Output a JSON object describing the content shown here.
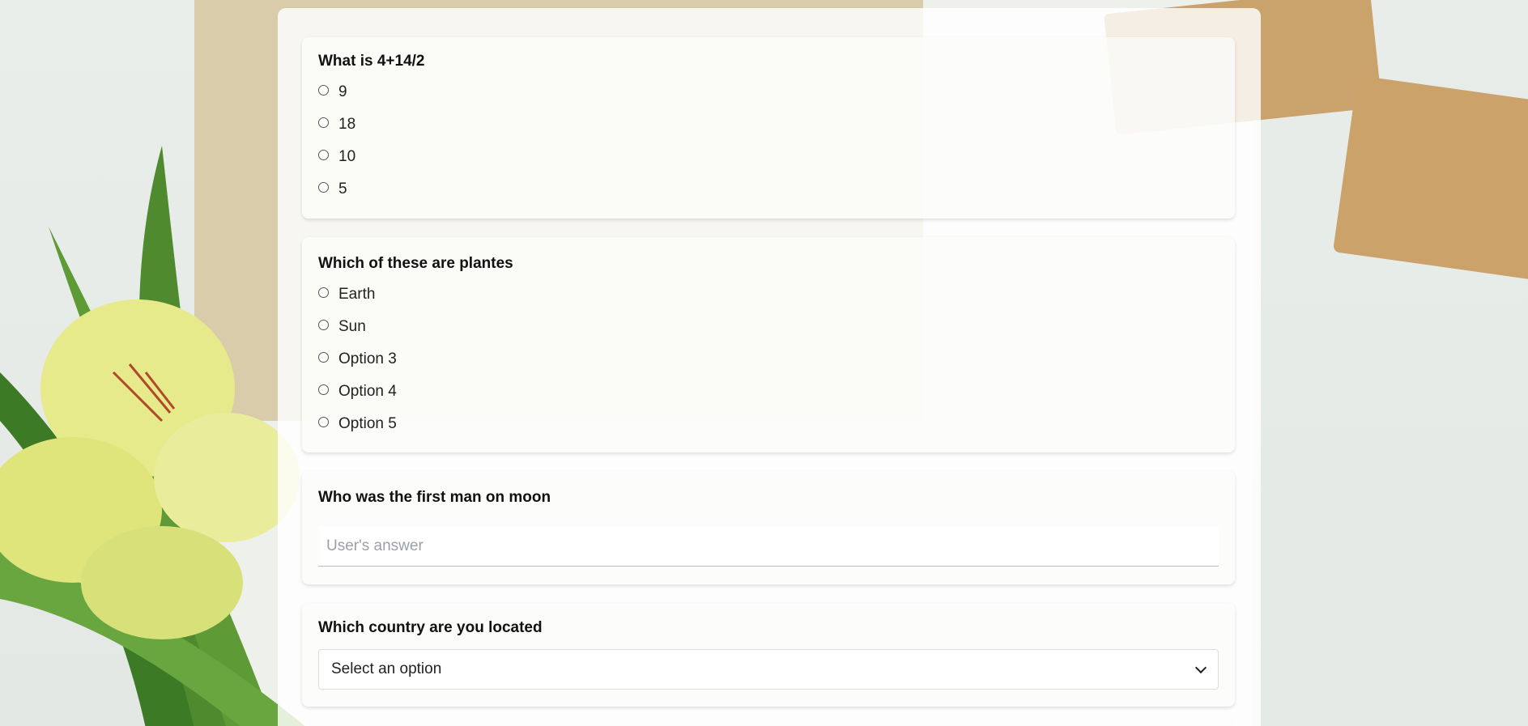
{
  "questions": [
    {
      "title": "What is 4+14/2",
      "options": [
        "9",
        "18",
        "10",
        "5"
      ]
    },
    {
      "title": "Which of these are plantes",
      "options": [
        "Earth",
        "Sun",
        "Option 3",
        "Option 4",
        "Option 5"
      ]
    },
    {
      "title": "Who was the first man on moon",
      "placeholder": "User's answer"
    },
    {
      "title": "Which country are you located",
      "selected": "Select an option"
    }
  ],
  "icons": {
    "radio": "radio-unchecked-icon",
    "chevron": "chevron-down-icon"
  }
}
